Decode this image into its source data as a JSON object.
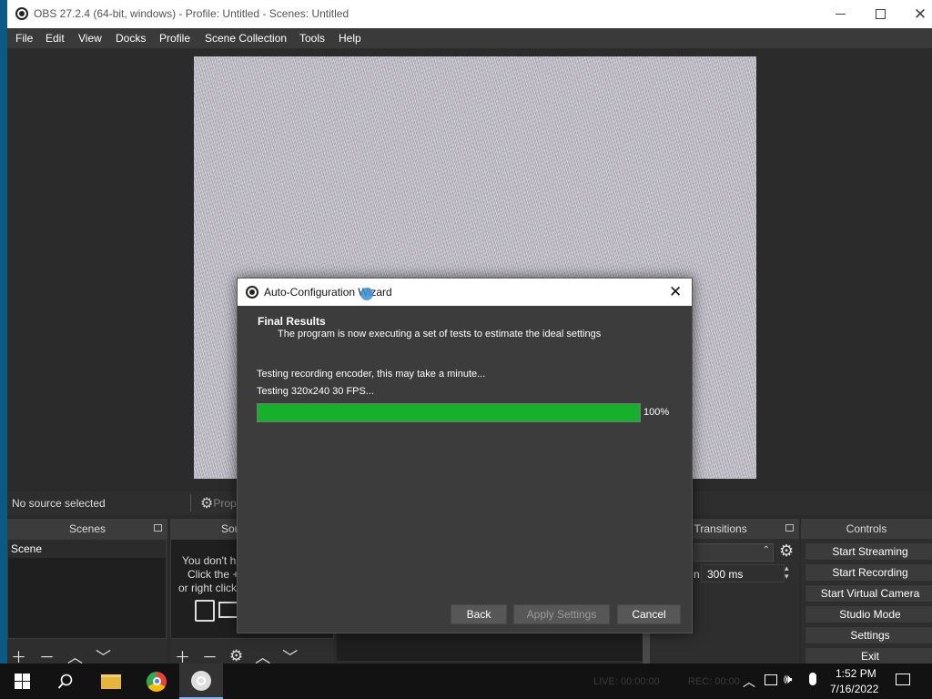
{
  "window": {
    "title": "OBS 27.2.4 (64-bit, windows) - Profile: Untitled - Scenes: Untitled",
    "minimize_icon": "minimize-icon",
    "maximize_icon": "maximize-icon",
    "close_icon": "close-icon"
  },
  "menu": [
    "File",
    "Edit",
    "View",
    "Docks",
    "Profile",
    "Scene Collection",
    "Tools",
    "Help"
  ],
  "source_bar": {
    "status": "No source selected",
    "properties_label": "Prope"
  },
  "scenes": {
    "title": "Scenes",
    "items": [
      "Scene"
    ]
  },
  "sources": {
    "title": "Sou",
    "empty_line1": "You don't h",
    "empty_line2": "Click the +",
    "empty_line3": "or right click"
  },
  "transitions": {
    "title": "ne Transitions",
    "duration_label": "n",
    "duration_value": "300 ms"
  },
  "controls": {
    "title": "Controls",
    "buttons": [
      "Start Streaming",
      "Start Recording",
      "Start Virtual Camera",
      "Studio Mode",
      "Settings",
      "Exit"
    ]
  },
  "dialog": {
    "title": "Auto-Configuration Wizard",
    "section_title": "Final Results",
    "section_subtitle": "The program is now executing a set of tests to estimate the ideal settings",
    "status_line1": "Testing recording encoder, this may take a minute...",
    "status_line2": "Testing 320x240 30 FPS...",
    "progress_value": 100,
    "progress_label": "100%",
    "progress_color": "#16b12a",
    "buttons": {
      "back": "Back",
      "apply": "Apply Settings",
      "cancel": "Cancel"
    }
  },
  "statusbar": {
    "live": "LIVE: 00:00:00",
    "rec": "REC: 00:00"
  },
  "taskbar": {
    "time": "1:52 PM",
    "date": "7/16/2022"
  }
}
